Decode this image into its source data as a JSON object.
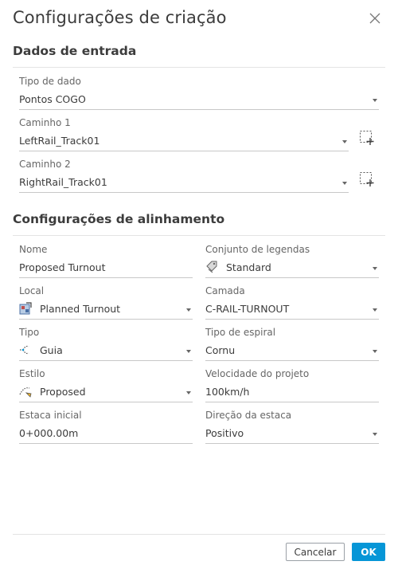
{
  "dialog": {
    "title": "Configurações de criação",
    "cancel_label": "Cancelar",
    "ok_label": "OK"
  },
  "input_section": {
    "title": "Dados de entrada",
    "data_type": {
      "label": "Tipo de dado",
      "value": "Pontos COGO"
    },
    "path1": {
      "label": "Caminho 1",
      "value": "LeftRail_Track01"
    },
    "path2": {
      "label": "Caminho 2",
      "value": "RightRail_Track01"
    }
  },
  "alignment_section": {
    "title": "Configurações de alinhamento",
    "name": {
      "label": "Nome",
      "value": "Proposed Turnout"
    },
    "label_set": {
      "label": "Conjunto de legendas",
      "value": "Standard",
      "icon": "label-set-icon"
    },
    "site": {
      "label": "Local",
      "value": "Planned Turnout",
      "icon": "site-icon"
    },
    "layer": {
      "label": "Camada",
      "value": "C-RAIL-TURNOUT"
    },
    "type": {
      "label": "Tipo",
      "value": "Guia",
      "icon": "alignment-type-icon"
    },
    "spiral_type": {
      "label": "Tipo de espiral",
      "value": "Cornu"
    },
    "style": {
      "label": "Estilo",
      "value": "Proposed",
      "icon": "alignment-style-icon"
    },
    "design_speed": {
      "label": "Velocidade do projeto",
      "value": "100km/h"
    },
    "start_station": {
      "label": "Estaca inicial",
      "value": "0+000.00m"
    },
    "station_direction": {
      "label": "Direção da estaca",
      "value": "Positivo"
    }
  },
  "colors": {
    "accent": "#0696d7",
    "text": "#3c3c3c",
    "muted": "#666666"
  }
}
